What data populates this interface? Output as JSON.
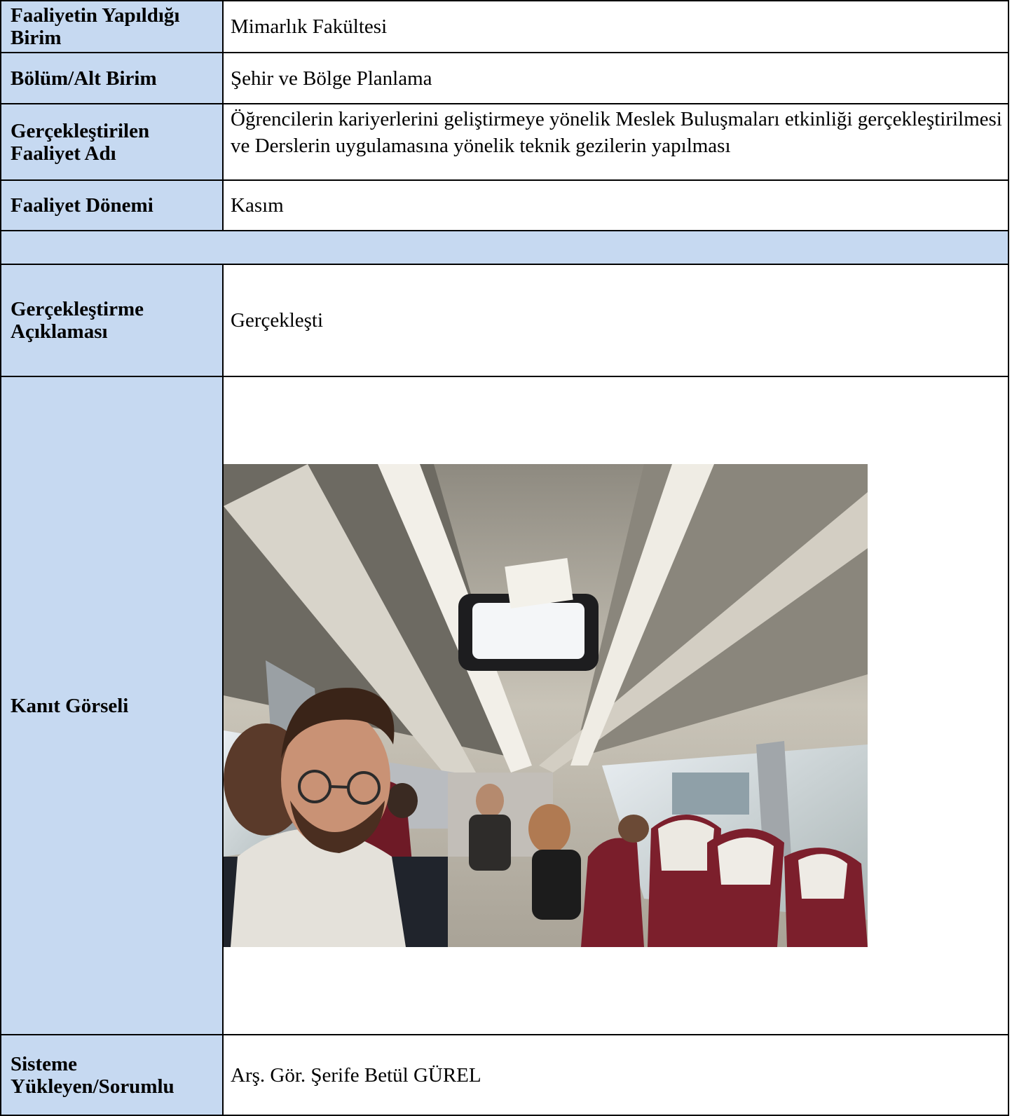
{
  "rows": [
    {
      "label": "Faaliyetin Yapıldığı Birim",
      "value": "Mimarlık Fakültesi"
    },
    {
      "label": "Bölüm/Alt Birim",
      "value": "Şehir ve Bölge Planlama"
    },
    {
      "label": "Gerçekleştirilen Faaliyet Adı",
      "value": "Öğrencilerin kariyerlerini geliştirmeye yönelik Meslek Buluşmaları etkinliği gerçekleştirilmesi ve Derslerin uygulamasına yönelik teknik gezilerin yapılması"
    },
    {
      "label": "Faaliyet Dönemi",
      "value": "Kasım"
    },
    {
      "label": "Gerçekleştirme Açıklaması",
      "value": "Gerçekleşti"
    },
    {
      "label": "Kanıt Görseli"
    },
    {
      "label": "Sisteme Yükleyen/Sorumlu",
      "value": "Arş. Gör. Şerife Betül GÜREL"
    }
  ],
  "colors": {
    "label_bg": "#c6d9f1",
    "border": "#000000"
  }
}
